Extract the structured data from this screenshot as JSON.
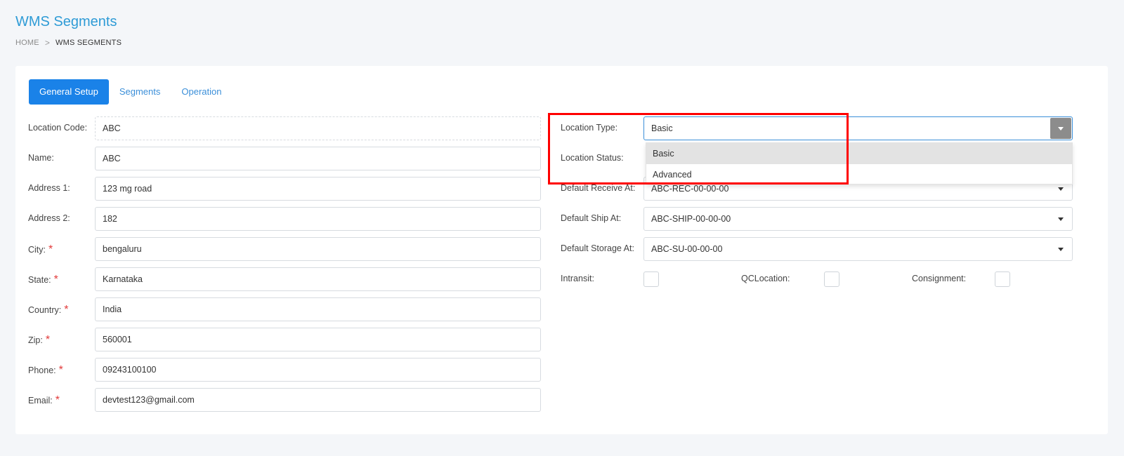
{
  "header": {
    "title": "WMS Segments",
    "breadcrumb": {
      "home": "HOME",
      "separator": ">",
      "current": "WMS SEGMENTS"
    }
  },
  "tabs": [
    {
      "label": "General Setup",
      "active": true
    },
    {
      "label": "Segments",
      "active": false
    },
    {
      "label": "Operation",
      "active": false
    }
  ],
  "left_form": {
    "location_code": {
      "label": "Location Code:",
      "value": "ABC"
    },
    "name": {
      "label": "Name:",
      "value": "ABC"
    },
    "address1": {
      "label": "Address 1:",
      "value": "123 mg road"
    },
    "address2": {
      "label": "Address 2:",
      "value": "182"
    },
    "city": {
      "label": "City:",
      "required": "*",
      "value": "bengaluru"
    },
    "state": {
      "label": "State:",
      "required": "*",
      "value": "Karnataka"
    },
    "country": {
      "label": "Country:",
      "required": "*",
      "value": "India"
    },
    "zip": {
      "label": "Zip:",
      "required": "*",
      "value": "560001"
    },
    "phone": {
      "label": "Phone:",
      "required": "*",
      "value": "09243100100"
    },
    "email": {
      "label": "Email:",
      "required": "*",
      "value": "devtest123@gmail.com"
    }
  },
  "right_form": {
    "location_type": {
      "label": "Location Type:",
      "value": "Basic",
      "options": [
        "Basic",
        "Advanced"
      ]
    },
    "location_status": {
      "label": "Location Status:"
    },
    "default_receive": {
      "label": "Default Receive At:",
      "value": "ABC-REC-00-00-00"
    },
    "default_ship": {
      "label": "Default Ship At:",
      "value": "ABC-SHIP-00-00-00"
    },
    "default_storage": {
      "label": "Default Storage At:",
      "value": "ABC-SU-00-00-00"
    },
    "intransit": {
      "label": "Intransit:",
      "checked": false
    },
    "qclocation": {
      "label": "QCLocation:",
      "checked": false
    },
    "consignment": {
      "label": "Consignment:",
      "checked": false
    }
  },
  "colors": {
    "accent": "#1a82e8",
    "title": "#2e9bd6",
    "required": "#e23b3b",
    "highlight": "#ff0000"
  }
}
